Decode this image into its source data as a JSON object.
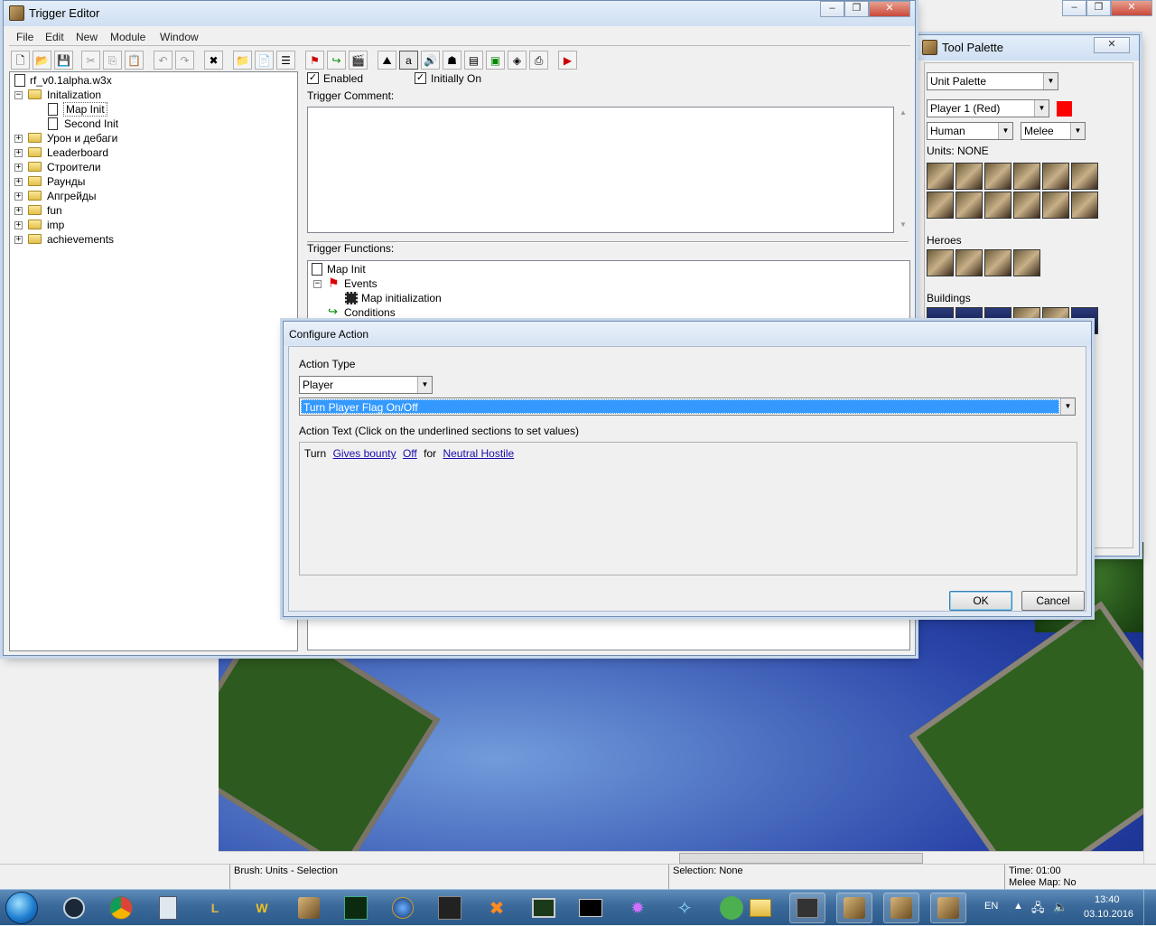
{
  "trigger_editor": {
    "title": "Trigger Editor",
    "menu": [
      "File",
      "Edit",
      "New",
      "Module",
      "Window"
    ],
    "tree": {
      "root": "rf_v0.1alpha.w3x",
      "items": [
        {
          "label": "Initalization",
          "children": [
            "Map Init",
            "Second Init"
          ]
        },
        {
          "label": "Урон и дебаги"
        },
        {
          "label": "Leaderboard"
        },
        {
          "label": "Строители"
        },
        {
          "label": "Раунды"
        },
        {
          "label": "Апгрейды"
        },
        {
          "label": "fun"
        },
        {
          "label": "imp"
        },
        {
          "label": "achievements"
        }
      ]
    },
    "enabled_label": "Enabled",
    "initially_on_label": "Initially On",
    "comment_label": "Trigger Comment:",
    "functions_label": "Trigger Functions:",
    "functions": {
      "trigger": "Map Init",
      "events": "Events",
      "event_item": "Map initialization",
      "conditions": "Conditions"
    }
  },
  "tool_palette": {
    "title": "Tool Palette",
    "palette": "Unit Palette",
    "player": "Player 1 (Red)",
    "player_color": "#ff0000",
    "race": "Human",
    "mode": "Melee",
    "units_label": "Units: NONE",
    "heroes_label": "Heroes",
    "buildings_label": "Buildings"
  },
  "dialog": {
    "title": "Configure Action",
    "action_type_label": "Action Type",
    "category": "Player",
    "action": "Turn Player Flag On/Off",
    "action_text_label": "Action Text (Click on the underlined sections to set values)",
    "text_parts": {
      "w1": "Turn",
      "flag": "Gives bounty",
      "state": "Off",
      "w2": "for",
      "player": "Neutral Hostile"
    },
    "ok": "OK",
    "cancel": "Cancel"
  },
  "statusbar": {
    "brush": "Brush: Units - Selection",
    "selection": "Selection: None",
    "time": "Time: 01:00",
    "map": "Melee Map: No"
  },
  "taskbar": {
    "lang": "EN",
    "clock_time": "13:40",
    "clock_date": "03.10.2016"
  }
}
